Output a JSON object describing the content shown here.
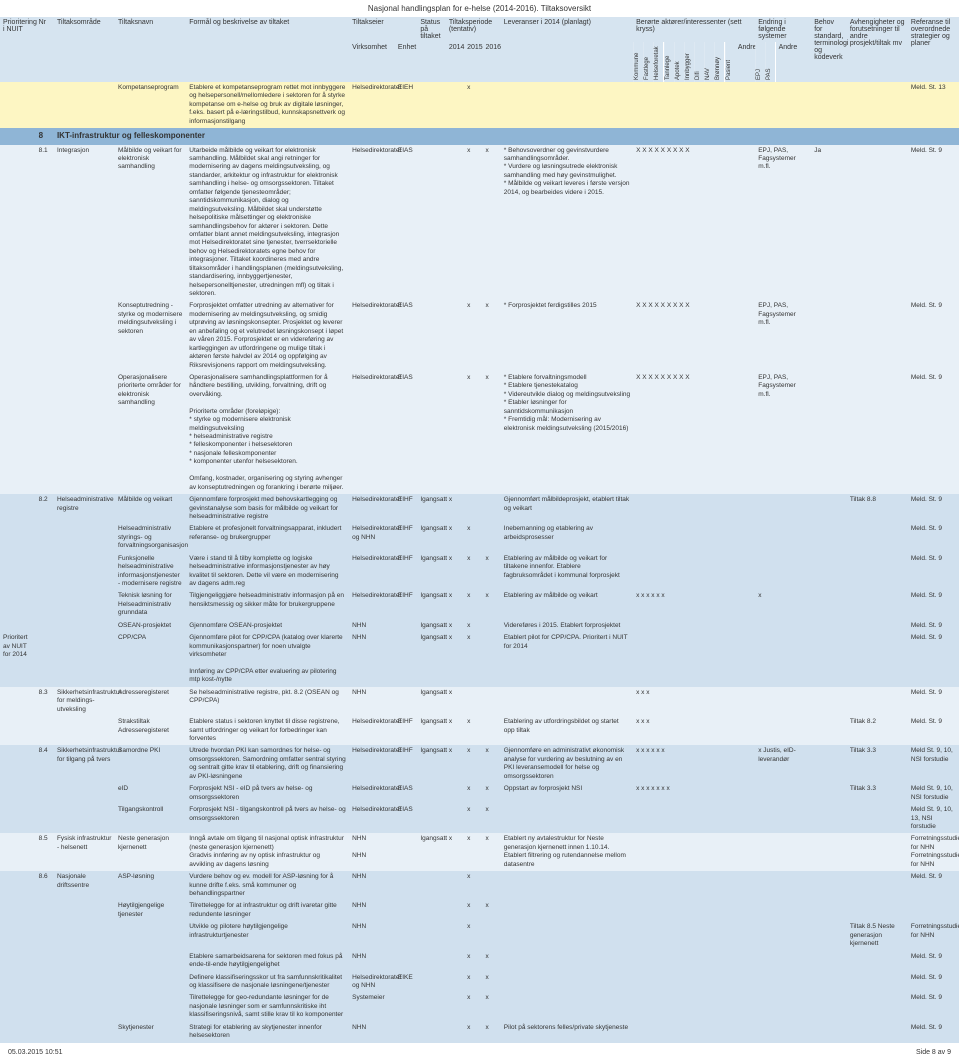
{
  "page_title": "Nasjonal handlingsplan for e-helse (2014-2016). Tiltaksoversikt",
  "header": {
    "prioritering": "Prioritering i NUIT",
    "nr": "Nr",
    "tiltaksomrade": "Tiltaksområde",
    "tiltaksnavn": "Tiltaksnavn",
    "formaal": "Formål og beskrivelse av tiltaket",
    "tiltakseier": "Tiltakseier",
    "status": "Status på tiltaket",
    "periode": "Tiltaksperiode (tentativ)",
    "leveranser": "Leveranser i 2014 (planlagt)",
    "berorte": "Berørte aktører/interessenter (sett kryss)",
    "endring": "Endring i følgende systemer",
    "behov": "Behov for standard, terminologi og kodeverk",
    "avhengigheter": "Avhengigheter og forutsetninger til andre prosjekt/tiltak mv",
    "referanse": "Referanse til overordnede strategier og planer",
    "virksomhet": "Virksomhet",
    "enhet": "Enhet",
    "y2014": "2014",
    "y2015": "2015",
    "y2016": "2016",
    "andre": "Andre",
    "epj": "EPJ",
    "pas": "PAS",
    "andre2": "Andre"
  },
  "vert_headers": {
    "kommune": "Kommune",
    "fastlege": "Fastlege",
    "helseforetak": "Helseforetak",
    "tannlege": "Tannlege",
    "apotek": "Apotek",
    "innbygger": "Innbygger",
    "difi": "Difi",
    "nav": "NAV",
    "bronnoy": "Brønnøy",
    "pasient": "Pasient"
  },
  "section8": {
    "nr": "8",
    "title": "IKT-infrastruktur og felleskomponenter"
  },
  "rows": [
    {
      "band": "band-yellow",
      "nr": "",
      "omrade": "",
      "navn": "Kompetanseprogram",
      "formaal": "Etablere et kompetanseprogram rettet mot innbyggere og helsepersonell/mellomledere i sektoren for å styrke kompetanse om e-helse og bruk av digitale løsninger, f.eks. basert på e-læringstilbud, kunnskapsnettverk og informasjonstilgang",
      "eier": "Helsedirektoratet",
      "enhet": "EIEH",
      "p14": "",
      "p15": "x",
      "p16": "",
      "lever": "",
      "marks": "",
      "endr": "",
      "behov": "",
      "avh": "",
      "ref": "Meld. St. 13"
    },
    {
      "band": "band-lightblue",
      "nr": "8.1",
      "omrade": "Integrasjon",
      "navn": "Målbilde og veikart for elektronisk samhandling",
      "formaal": "Utarbeide målbilde og veikart for elektronisk samhandling. Målbildet skal angi retninger for modernisering av dagens meldingsutveksling, og standarder, arkitektur og infrastruktur for elektronisk samhandling i helse- og omsorgssektoren. Tiltaket omfatter følgende tjenesteområder; sanntidskommunikasjon, dialog og meldingsutveksling. Målbildet skal understøtte helsepolitiske målsettinger og elektroniske samhandlingsbehov for aktører i sektoren. Dette omfatter blant annet meldingsutveksling, integrasjon mot Helsedirektoratet sine tjenester, tverrsektorielle behov og Helsedirektoratets egne behov for integrasjoner. Tiltaket koordineres med andre tiltaksområder i handlingsplanen (meldingsutveksling, standardisering, innbyggertjenester, helsepersonelltjenester, utredningen mfl) og tiltak i sektoren.",
      "eier": "Helsedirektoratet",
      "enhet": "EIAS",
      "p14": "",
      "p15": "x",
      "p16": "x",
      "lever": "* Behovsoverdner og gevinstvurdere samhandlingsområder.\n* Vurdere og løsningsutrede elektronisk samhandling med høy gevinstmulighet.\n* Målbilde og veikart leveres i første versjon 2014, og bearbeides videre i 2015.",
      "marks": "X X X X X X X X X",
      "endr": "EPJ, PAS, Fagsystemer m.fl.",
      "behov": "Ja",
      "avh": "",
      "ref": "Meld. St. 9"
    },
    {
      "band": "band-lightblue",
      "nr": "",
      "omrade": "",
      "navn": "Konseptutredning - styrke og modernisere meldingsutveksling i sektoren",
      "formaal": "Forprosjektet omfatter utredning av alternativer for modernisering av meldingsutveksling, og smidig utprøving av løsningskonsepter. Prosjektet og leverer en anbefaling og et velutredet løsningskonsept i løpet av våren 2015. Forprosjektet er en videreføring av kartleggingen av utfordringene og mulige tiltak i aktøren første halvdel av 2014 og oppfølging av Riksrevisjonens rapport om meldingsutveksling.",
      "eier": "Helsedirektoratet",
      "enhet": "EIAS",
      "p14": "",
      "p15": "x",
      "p16": "x",
      "lever": "* Forprosjektet ferdigstilles 2015",
      "marks": "X X X X X X X X X",
      "endr": "EPJ, PAS, Fagsystemer m.fl.",
      "behov": "",
      "avh": "",
      "ref": "Meld. St. 9"
    },
    {
      "band": "band-lightblue",
      "nr": "",
      "omrade": "",
      "navn": "Operasjonalisere prioriterte områder for elektronisk samhandling",
      "formaal": "Operasjonalisere samhandlingsplattformen for å håndtere bestilling, utvikling, forvaltning, drift og overvåking.\n\nPrioriterte områder (foreløpige):\n* styrke og modernisere elektronisk meldingsutveksling\n* helseadministrative registre\n* felleskomponenter i helsesektoren\n* nasjonale felleskomponenter\n* komponenter utenfor helsesektoren.\n\nOmfang, kostnader, organisering og styring avhenger av konseptutredningen og forankring i berørte miljøer.",
      "eier": "Helsedirektoratet",
      "enhet": "EIAS",
      "p14": "",
      "p15": "x",
      "p16": "x",
      "lever": "* Etablere forvaltningsmodell\n* Etablere tjenestekatalog\n* Videreutvikle dialog og meldingsutveksling\n* Etabler løsninger for sanntidskommunikasjon\n* Fremtidig mål: Modernisering av elektronisk meldingsutveksling (2015/2016)",
      "marks": "X X X X X X X X X",
      "endr": "EPJ, PAS, Fagsystemer m.fl.",
      "behov": "",
      "avh": "",
      "ref": "Meld. St. 9"
    },
    {
      "band": "band-blue",
      "nr": "8.2",
      "omrade": "Helseadministrative registre",
      "navn": "Målbilde og veikart",
      "formaal": "Gjennomføre forprosjekt med behovskartlegging og gevinstanalyse som basis for målbilde og veikart for helseadministrative registre",
      "eier": "Helsedirektoratet",
      "enhet": "EIHF",
      "status": "Igangsatt",
      "p14": "x",
      "p15": "",
      "p16": "",
      "lever": "Gjennomført målbildeprosjekt, etablert tiltak og veikart",
      "marks": "",
      "endr": "",
      "behov": "",
      "avh": "Tiltak 8.8",
      "ref": "Meld. St. 9"
    },
    {
      "band": "band-blue",
      "nr": "",
      "omrade": "",
      "navn": "Helseadministrativ styrings- og forvaltningsorganisasjon",
      "formaal": "Etablere et profesjonelt forvaltningsapparat, inkludert referanse- og brukergrupper",
      "eier": "Helsedirektoratet og NHN",
      "enhet": "EIHF",
      "status": "Igangsatt",
      "p14": "x",
      "p15": "x",
      "p16": "",
      "lever": "Inebemanning og etablering av arbeidsprosesser",
      "marks": "",
      "endr": "",
      "behov": "",
      "avh": "",
      "ref": "Meld. St. 9"
    },
    {
      "band": "band-blue",
      "nr": "",
      "omrade": "",
      "navn": "Funksjonelle helseadministrative informasjonstjenester - modernisere registre",
      "formaal": "Være i stand til å tilby komplette og logiske helseadministrative informasjonstjenester av høy kvalitet til sektoren. Dette vil være en modernisering av dagens adm.reg",
      "eier": "Helsedirektoratet",
      "enhet": "EIHF",
      "status": "Igangsatt",
      "p14": "x",
      "p15": "x",
      "p16": "x",
      "lever": "Etablering av målbilde og veikart for tiltakene innenfor. Etablere fagbruksområdet i kommunal forprosjekt",
      "marks": "",
      "endr": "",
      "behov": "",
      "avh": "",
      "ref": "Meld. St. 9"
    },
    {
      "band": "band-blue",
      "nr": "",
      "omrade": "",
      "navn": "Teknisk løsning for Helseadministrativ grunndata",
      "formaal": "Tilgjengeliggjøre helseadministrativ informasjon på en hensiktsmessig og sikker måte for brukergruppene",
      "eier": "Helsedirektoratet",
      "enhet": "EIHF",
      "status": "Igangsatt",
      "p14": "x",
      "p15": "x",
      "p16": "x",
      "lever": "Etablering av målbilde og veikart",
      "marks": "x x x x x x",
      "endr": "x",
      "behov": "",
      "avh": "",
      "ref": "Meld. St. 9"
    },
    {
      "band": "band-blue",
      "nr": "",
      "omrade": "",
      "navn": "OSEAN-prosjektet",
      "formaal": "Gjennomføre OSEAN-prosjektet",
      "eier": "NHN",
      "enhet": "",
      "status": "Igangsatt",
      "p14": "x",
      "p15": "x",
      "p16": "",
      "lever": "Videreføres i 2015. Etablert forprosjektet",
      "marks": "",
      "endr": "",
      "behov": "",
      "avh": "",
      "ref": "Meld. St. 9"
    },
    {
      "band": "band-blue",
      "prio": "Prioritert av NUIT for 2014",
      "nr": "",
      "omrade": "",
      "navn": "CPP/CPA",
      "formaal": "Gjennomføre pilot for CPP/CPA (katalog over klarerte kommunikasjonspartner) for noen utvalgte virksomheter\n\nInnføring av CPP/CPA etter evaluering av pilotering mtp kost-/nytte",
      "eier": "NHN",
      "enhet": "",
      "status": "Igangsatt",
      "p14": "x",
      "p15": "x",
      "p16": "",
      "lever": "Etablert pilot for CPP/CPA. Prioritert i NUIT for 2014",
      "marks": "",
      "endr": "",
      "behov": "",
      "avh": "",
      "ref": "Meld. St. 9"
    },
    {
      "band": "band-lightblue",
      "nr": "8.3",
      "omrade": "Sikkerhetsinfrastruktur for meldings-utveksling",
      "navn": "Adresseregisteret",
      "formaal": "Se helseadministrative registre, pkt. 8.2 (OSEAN og CPP/CPA)",
      "eier": "NHN",
      "enhet": "",
      "status": "Igangsatt",
      "p14": "x",
      "p15": "",
      "p16": "",
      "lever": "",
      "marks": "x x      x",
      "endr": "",
      "behov": "",
      "avh": "",
      "ref": "Meld. St. 9"
    },
    {
      "band": "band-lightblue",
      "nr": "",
      "omrade": "",
      "navn": "Strakstiltak Adresseregisteret",
      "formaal": "Etablere status i sektoren knyttet til disse registrene, samt utfordringer og veikart for forbedringer kan forventes",
      "eier": "Helsedirektoratet",
      "enhet": "EIHF",
      "status": "Igangsatt",
      "p14": "x",
      "p15": "x",
      "p16": "",
      "lever": "Etablering av utfordringsbildet og startet opp tiltak",
      "marks": "x x      x",
      "endr": "",
      "behov": "",
      "avh": "Tiltak 8.2",
      "ref": "Meld. St. 9"
    },
    {
      "band": "band-blue",
      "nr": "8.4",
      "omrade": "Sikkerhetsinfrastruktur for tilgang på tvers",
      "navn": "Samordne PKI",
      "formaal": "Utrede hvordan PKI kan samordnes for helse- og omsorgssektoren. Samordning omfatter sentral styring og sentralt gitte krav til etablering, drift og finansiering av PKI-løsningene",
      "eier": "Helsedirektoratet",
      "enhet": "EIHF",
      "status": "Igangsatt",
      "p14": "x",
      "p15": "x",
      "p16": "x",
      "lever": "Gjennomføre en administrativt økonomisk analyse for vurdering av beslutning av en PKI leveransemodell for helse og omsorgssektoren",
      "marks": "x x x x x x",
      "endr": "x Justis, eID-leverandør",
      "behov": "",
      "avh": "Tiltak 3.3",
      "ref": "Meld St. 9, 10, NSI forstudie"
    },
    {
      "band": "band-blue",
      "nr": "",
      "omrade": "",
      "navn": "eID",
      "formaal": "Forprosjekt NSI - eID på tvers av helse- og omsorgssektoren",
      "eier": "Helsedirektoratet",
      "enhet": "EIAS",
      "p14": "",
      "p15": "x",
      "p16": "x",
      "lever": "Oppstart av forprosjekt NSI",
      "marks": "x x x x x x x",
      "endr": "",
      "behov": "",
      "avh": "Tiltak 3.3",
      "ref": "Meld St. 9, 10, NSI forstudie"
    },
    {
      "band": "band-blue",
      "nr": "",
      "omrade": "",
      "navn": "Tilgangskontroll",
      "formaal": "Forprosjekt NSI - tilgangskontroll på tvers av helse- og omsorgssektoren",
      "eier": "Helsedirektoratet",
      "enhet": "EIAS",
      "p14": "",
      "p15": "x",
      "p16": "x",
      "lever": "",
      "marks": "",
      "endr": "",
      "behov": "",
      "avh": "",
      "ref": "Meld St. 9, 10, 13, NSI forstudie"
    },
    {
      "band": "band-lightblue",
      "nr": "8.5",
      "omrade": "Fysisk infrastruktur - helsenett",
      "navn": "Neste generasjon kjernenett",
      "formaal": "Inngå avtale om tilgang til nasjonal optisk infrastruktur (neste generasjon kjernenett)\nGradvis innføring av ny optisk infrastruktur og avvikling av dagens løsning",
      "eier": "NHN\n\nNHN",
      "enhet": "",
      "status": "Igangsatt",
      "p14": "x",
      "p15": "x",
      "p16": "x",
      "lever": "Etablert ny avtalestruktur for Neste generasjon kjernenett innen 1.10.14. Etablert filtrering og rutendannelse mellom datasentre",
      "marks": "",
      "endr": "",
      "behov": "",
      "avh": "",
      "ref": "Forretningsstudiet for NHN\nForretningsstudiet for NHN"
    },
    {
      "band": "band-blue",
      "nr": "8.6",
      "omrade": "Nasjonale driftssentre",
      "navn": "ASP-løsning",
      "formaal": "Vurdere behov og ev. modell for ASP-løsning for å kunne drifte f.eks. små kommuner og behandlingspartner",
      "eier": "NHN",
      "enhet": "",
      "p14": "",
      "p15": "x",
      "p16": "",
      "lever": "",
      "marks": "",
      "endr": "",
      "behov": "",
      "avh": "",
      "ref": "Meld. St. 9"
    },
    {
      "band": "band-blue",
      "nr": "",
      "omrade": "",
      "navn": "Høytilgjengelige tjenester",
      "formaal": "Tilrettelegge for at infrastruktur og drift ivaretar gitte redundente løsninger",
      "eier": "NHN",
      "enhet": "",
      "p14": "",
      "p15": "x",
      "p16": "x",
      "lever": "",
      "marks": "",
      "endr": "",
      "behov": "",
      "avh": "",
      "ref": ""
    },
    {
      "band": "band-blue",
      "nr": "",
      "omrade": "",
      "navn": "",
      "formaal": "Utvikle og pilotere høytilgjengelige infrastrukturtjenester",
      "eier": "NHN",
      "enhet": "",
      "p14": "",
      "p15": "x",
      "p16": "",
      "lever": "",
      "marks": "",
      "endr": "",
      "behov": "",
      "avh": "Tiltak 8.5 Neste generasjon kjernenett",
      "ref": "Forretningsstudiet for NHN"
    },
    {
      "band": "band-blue",
      "nr": "",
      "omrade": "",
      "navn": "",
      "formaal": "Etablere samarbeidsarena for sektoren med fokus på ende-til-ende høytilgjengelighet",
      "eier": "NHN",
      "enhet": "",
      "p14": "",
      "p15": "x",
      "p16": "x",
      "lever": "",
      "marks": "",
      "endr": "",
      "behov": "",
      "avh": "",
      "ref": "Meld. St. 9"
    },
    {
      "band": "band-blue",
      "nr": "",
      "omrade": "",
      "navn": "",
      "formaal": "Definere klassifiseringsskor ut fra samfunnskritikalitet og klassifisere de nasjonale løsningene/tjenester",
      "eier": "Helsedirektoratet og NHN",
      "enhet": "EIKE",
      "p14": "",
      "p15": "x",
      "p16": "x",
      "lever": "",
      "marks": "",
      "endr": "",
      "behov": "",
      "avh": "",
      "ref": "Meld. St. 9"
    },
    {
      "band": "band-blue",
      "nr": "",
      "omrade": "",
      "navn": "",
      "formaal": "Tilrettelegge for geo-redundante løsninger for de nasjonale løsninger som er samfunnskritiske iht klassifiseringsnivå, samt stille krav til ko komponenter",
      "eier": "Systemeier",
      "enhet": "",
      "p14": "",
      "p15": "x",
      "p16": "x",
      "lever": "",
      "marks": "",
      "endr": "",
      "behov": "",
      "avh": "",
      "ref": "Meld. St. 9"
    },
    {
      "band": "band-blue",
      "nr": "",
      "omrade": "",
      "navn": "Skytjenester",
      "formaal": "Strategi for etablering av skytjenester innenfor helsesektoren",
      "eier": "NHN",
      "enhet": "",
      "p14": "",
      "p15": "x",
      "p16": "x",
      "lever": "Pilot på sektorens felles/private skytjeneste",
      "marks": "",
      "endr": "",
      "behov": "",
      "avh": "",
      "ref": "Meld. St. 9"
    }
  ],
  "footer": {
    "left": "05.03.2015 10:51",
    "right": "Side 8 av 9"
  }
}
